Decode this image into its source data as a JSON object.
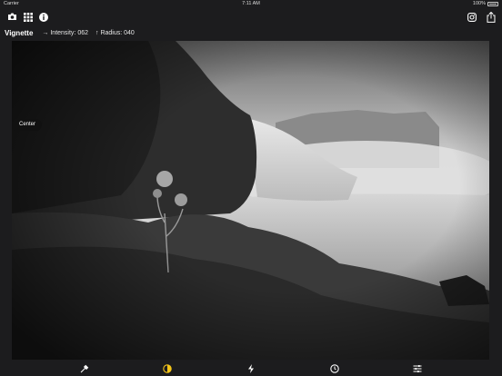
{
  "status_bar": {
    "carrier": "Carrier",
    "time": "7:11 AM",
    "battery": "100%"
  },
  "toolbar": {
    "left_icons": [
      "camera-icon",
      "grid-icon",
      "info-icon"
    ],
    "right_icons": [
      "instagram-icon",
      "share-icon"
    ]
  },
  "adjustment": {
    "title": "Vignette",
    "intensity_label": "→ Intensity: 062",
    "radius_label": "↑ Radius: 040"
  },
  "overlay": {
    "center_label": "Center"
  },
  "bottom_tools": [
    "eyedropper-icon",
    "contrast-icon",
    "lightning-icon",
    "timer-icon",
    "sliders-icon"
  ],
  "colors": {
    "background": "#1c1c1e",
    "accent": "#f5c518"
  }
}
